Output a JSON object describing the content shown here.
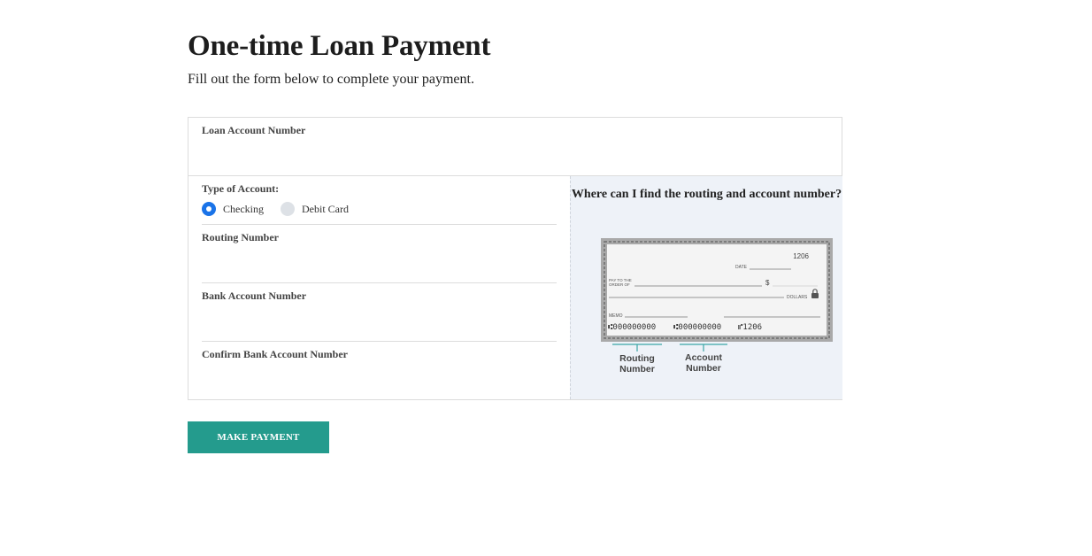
{
  "page": {
    "title": "One-time Loan Payment",
    "subtitle": "Fill out the form below to complete your payment."
  },
  "form": {
    "loan_account_number": {
      "label": "Loan Account Number",
      "value": ""
    },
    "account_type": {
      "label": "Type of Account:",
      "options": [
        "Checking",
        "Debit Card"
      ],
      "selected": "Checking"
    },
    "routing_number": {
      "label": "Routing Number",
      "value": ""
    },
    "bank_account_number": {
      "label": "Bank Account Number",
      "value": ""
    },
    "confirm_bank_account_number": {
      "label": "Confirm Bank Account Number",
      "value": ""
    }
  },
  "help": {
    "title": "Where can I find the routing and account number?",
    "check": {
      "check_number": "1206",
      "date_label": "DATE",
      "pay_to_line1": "PAY TO THE",
      "pay_to_line2": "ORDER OF",
      "dollar_sign": "$",
      "dollars_label": "DOLLARS",
      "memo_label": "MEMO",
      "micr_routing": "⑆000000000",
      "micr_account": "⑆000000000",
      "micr_check": "⑈1206"
    },
    "routing_caption_1": "Routing",
    "routing_caption_2": "Number",
    "account_caption_1": "Account",
    "account_caption_2": "Number",
    "accent_color": "#3aa6a6"
  },
  "actions": {
    "submit_label": "MAKE PAYMENT",
    "submit_color": "#249b8d"
  }
}
